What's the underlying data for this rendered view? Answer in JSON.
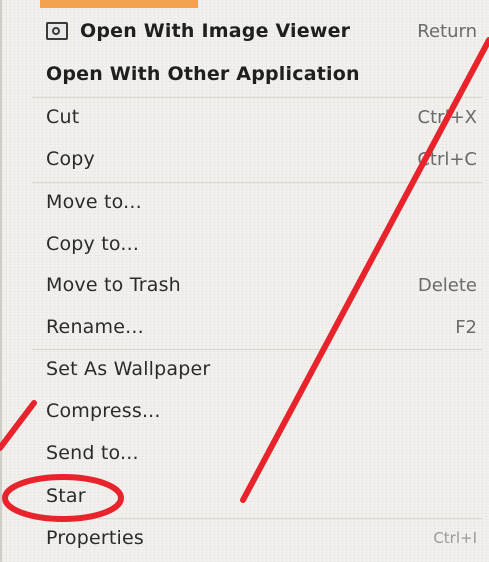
{
  "menu": {
    "items": [
      {
        "label": "Open With Image Viewer",
        "accel": "Return",
        "icon": "image-viewer-icon",
        "bold": true
      },
      {
        "label": "Open With Other Application",
        "accel": "",
        "bold": true
      },
      {
        "label": "Cut",
        "accel": "Ctrl+X"
      },
      {
        "label": "Copy",
        "accel": "Ctrl+C"
      },
      {
        "label": "Move to...",
        "accel": ""
      },
      {
        "label": "Copy to...",
        "accel": ""
      },
      {
        "label": "Move to Trash",
        "accel": "Delete"
      },
      {
        "label": "Rename...",
        "accel": "F2"
      },
      {
        "label": "Set As Wallpaper",
        "accel": ""
      },
      {
        "label": "Compress...",
        "accel": ""
      },
      {
        "label": "Send to...",
        "accel": ""
      },
      {
        "label": "Star",
        "accel": ""
      },
      {
        "label": "Properties",
        "accel": "Ctrl+I"
      }
    ]
  },
  "colors": {
    "menu_bg": "#f2f1ee",
    "text": "#2b2b2b",
    "accel_text": "#6a6a6a",
    "annotation_red": "#e8232b",
    "top_accent": "#f3a34f"
  }
}
